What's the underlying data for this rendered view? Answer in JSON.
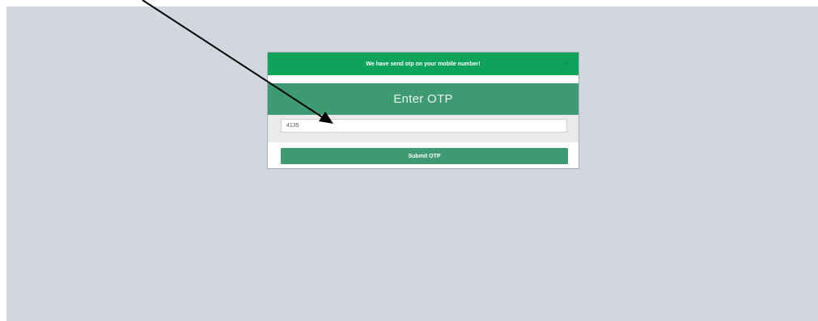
{
  "alert": {
    "message": "We have send otp on your mobile number!",
    "close_symbol": "×"
  },
  "modal": {
    "title": "Enter OTP"
  },
  "otp_field": {
    "value": "4135"
  },
  "submit": {
    "label": "Submit OTP"
  },
  "annotation": {
    "type": "arrow",
    "color": "#000000"
  },
  "colors": {
    "background": "#d1d6df",
    "alert": "#0ea35a",
    "accent": "#3e9a73"
  }
}
